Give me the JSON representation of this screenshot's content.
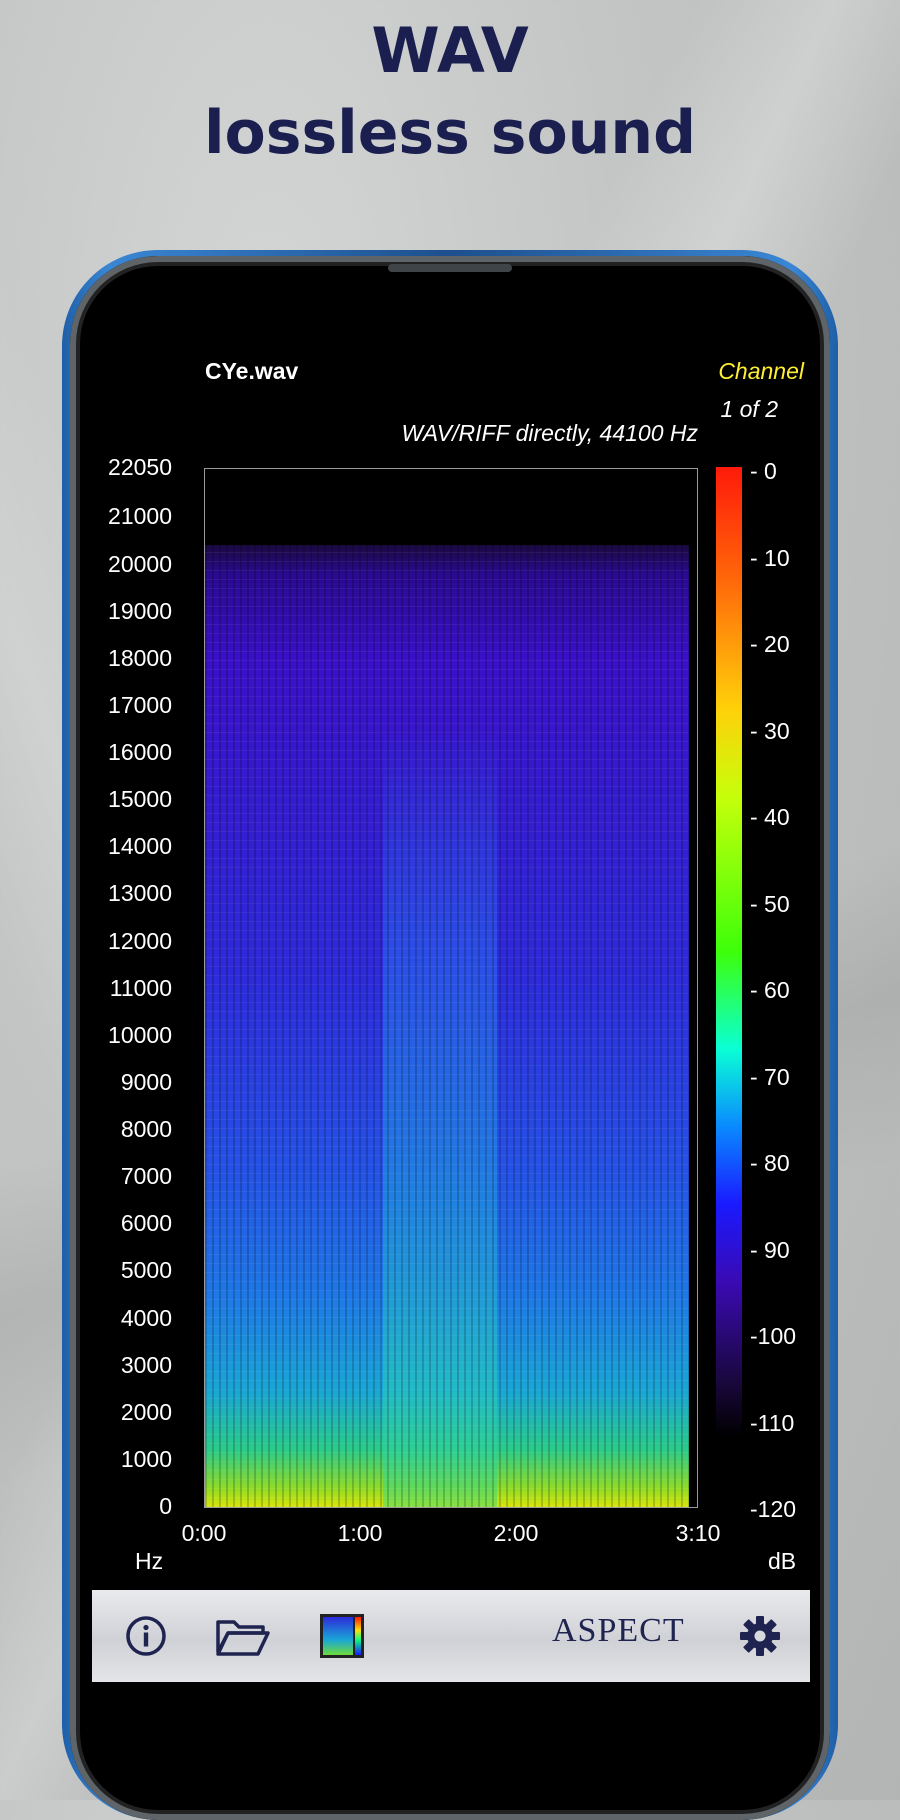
{
  "promo": {
    "headline_line1": "WAV",
    "headline_line2": "lossless sound"
  },
  "file": {
    "name": "CYe.wav",
    "format": "WAV/RIFF directly, 44100 Hz"
  },
  "channel": {
    "label": "Channel",
    "count": "1 of 2"
  },
  "chart_data": {
    "type": "heatmap",
    "xlabel": "",
    "ylabel": "Hz",
    "colorbar_label": "dB",
    "y_ticks": [
      "22050",
      "21000",
      "20000",
      "19000",
      "18000",
      "17000",
      "16000",
      "15000",
      "14000",
      "13000",
      "12000",
      "11000",
      "10000",
      "9000",
      "8000",
      "7000",
      "6000",
      "5000",
      "4000",
      "3000",
      "2000",
      "1000",
      "0"
    ],
    "y_tick_values": [
      22050,
      21000,
      20000,
      19000,
      18000,
      17000,
      16000,
      15000,
      14000,
      13000,
      12000,
      11000,
      10000,
      9000,
      8000,
      7000,
      6000,
      5000,
      4000,
      3000,
      2000,
      1000,
      0
    ],
    "x_ticks": [
      "0:00",
      "1:00",
      "2:00",
      "3:10"
    ],
    "x_tick_values_sec": [
      0,
      60,
      120,
      190
    ],
    "ylim": [
      0,
      22050
    ],
    "xlim_sec": [
      0,
      190
    ],
    "colorbar_ticks": [
      "- 0",
      "- 10",
      "- 20",
      "- 30",
      "- 40",
      "- 50",
      "- 60",
      "- 70",
      "- 80",
      "- 90",
      "-100",
      "-110",
      "-120"
    ],
    "colorbar_values": [
      0,
      -10,
      -20,
      -30,
      -40,
      -50,
      -60,
      -70,
      -80,
      -90,
      -100,
      -110,
      -120
    ],
    "colorbar_range": [
      -120,
      0
    ]
  },
  "toolbar": {
    "brand": "ASPECT",
    "icons": [
      "info-icon",
      "folder-open-icon",
      "spectrogram-palette-icon",
      "gear-icon"
    ]
  }
}
